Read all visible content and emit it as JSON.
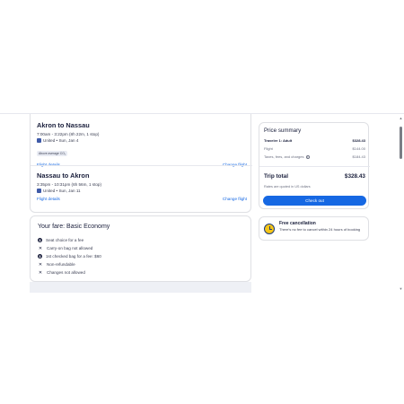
{
  "flights": [
    {
      "route": "Akron to Nassau",
      "time": "7:00am - 3:22pm (8h 22m, 1 stop)",
      "airline": "United • Sun, Jan 4",
      "badge": "Above average CO₂",
      "details_link": "Flight details",
      "change_link": "Change flight"
    },
    {
      "route": "Nassau to Akron",
      "time": "3:35pm - 10:31pm (6h 56m, 1 stop)",
      "airline": "United • Sun, Jan 11",
      "details_link": "Flight details",
      "change_link": "Change flight"
    }
  ],
  "fare": {
    "title": "Your fare: Basic Economy",
    "items": [
      {
        "icon": "dollar-icon",
        "text": "Seat choice for a fee"
      },
      {
        "icon": "x-icon",
        "text": "Carry-on bag not allowed"
      },
      {
        "icon": "dollar-icon",
        "text": "1st checked bag for a fee: $60"
      },
      {
        "icon": "x-icon",
        "text": "Non-refundable"
      },
      {
        "icon": "x-icon",
        "text": "Changes not allowed"
      }
    ]
  },
  "price_summary": {
    "title": "Price summary",
    "traveler_label": "Traveler 1: Adult",
    "traveler_value": "$328.43",
    "flight_label": "Flight",
    "flight_value": "$144.00",
    "taxes_label": "Taxes, fees, and charges",
    "taxes_value": "$184.43",
    "total_label": "Trip total",
    "total_value": "$328.43",
    "currency_note": "Rates are quoted in US dollars",
    "checkout_label": "Check out"
  },
  "cancellation": {
    "title": "Free cancellation",
    "desc": "There's no fee to cancel within 24 hours of booking"
  },
  "colors": {
    "accent": "#1668e3",
    "text": "#191e3b",
    "clock": "#f5c518"
  }
}
